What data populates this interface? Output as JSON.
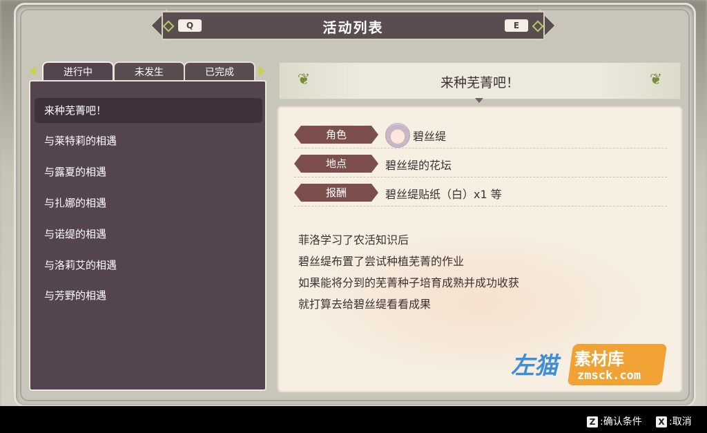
{
  "title_bar": {
    "title": "活动列表",
    "left_key": "Q",
    "right_key": "E"
  },
  "tabs": [
    {
      "label": "进行中",
      "active": true
    },
    {
      "label": "未发生",
      "active": false
    },
    {
      "label": "已完成",
      "active": false
    }
  ],
  "event_list": [
    {
      "label": "来种芜菁吧！",
      "selected": true
    },
    {
      "label": "与莱特莉的相遇",
      "selected": false
    },
    {
      "label": "与露夏的相遇",
      "selected": false
    },
    {
      "label": "与扎娜的相遇",
      "selected": false
    },
    {
      "label": "与诺缇的相遇",
      "selected": false
    },
    {
      "label": "与洛莉艾的相遇",
      "selected": false
    },
    {
      "label": "与芳野的相遇",
      "selected": false
    }
  ],
  "detail": {
    "quest_title": "来种芜菁吧！",
    "character_label": "角色",
    "character_value": "碧丝缇",
    "location_label": "地点",
    "location_value": "碧丝缇的花坛",
    "reward_label": "报酬",
    "reward_value": "碧丝缇贴纸（白）x1 等",
    "description": [
      "菲洛学习了农活知识后",
      "碧丝缇布置了尝试种植芜菁的作业",
      "如果能将分到的芜菁种子培育成熟并成功收获",
      "就打算去给碧丝缇看看成果"
    ]
  },
  "watermark": {
    "left": "左猫",
    "top": "素材库",
    "bottom": "zmsck.com"
  },
  "hints": {
    "confirm_key": "Z",
    "confirm_label": ":确认条件",
    "cancel_key": "X",
    "cancel_label": ":取消"
  },
  "colors": {
    "panel_dark": "#54444d",
    "badge": "#7d4f4c",
    "accent": "#c7d34a",
    "paper": "#f6efe2"
  }
}
